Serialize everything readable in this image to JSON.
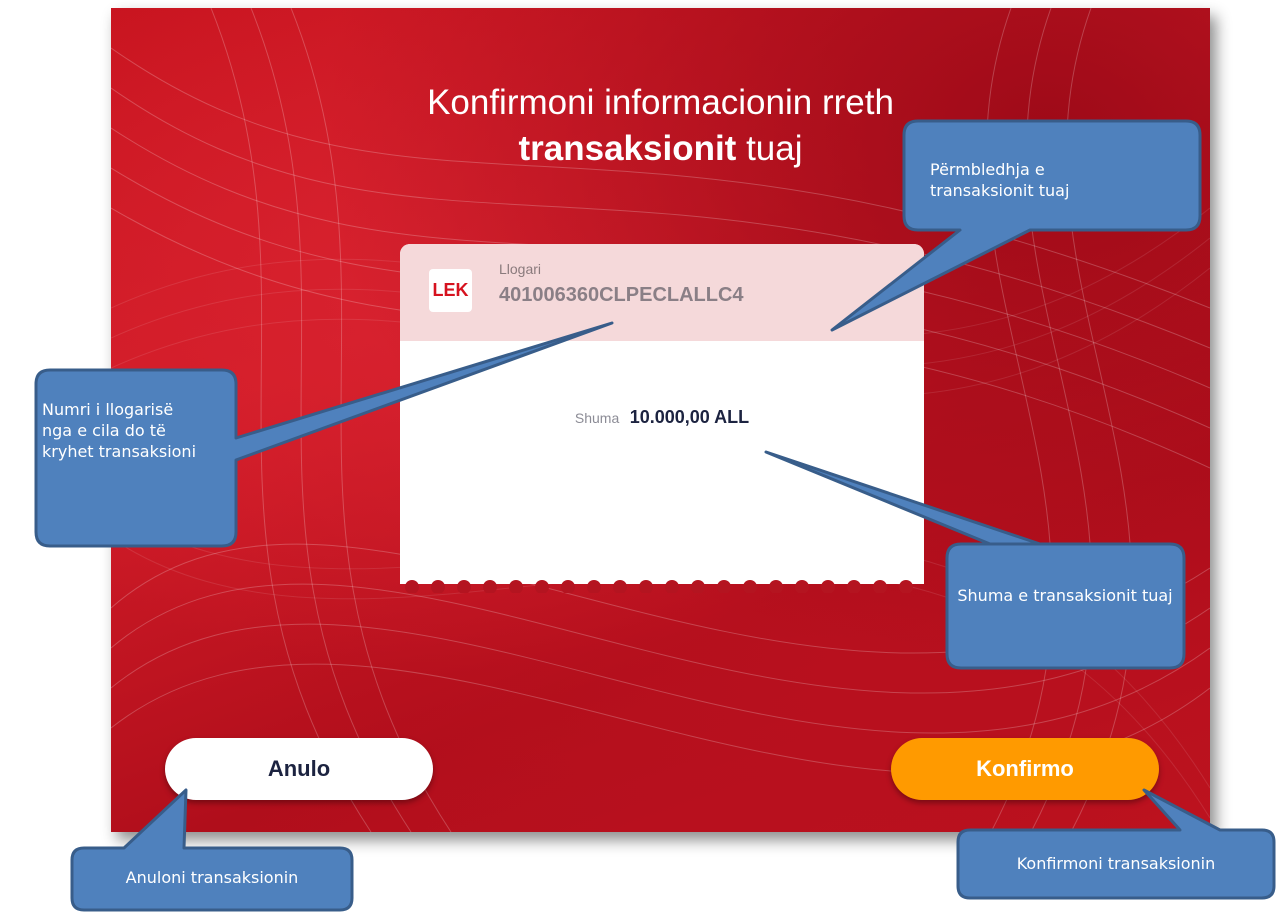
{
  "screen": {
    "title_line1": "Konfirmoni informacionin rreth",
    "title_bold": "transaksionit",
    "title_rest": " tuaj"
  },
  "card": {
    "currency_badge": "LEK",
    "account_label": "Llogari",
    "account_number": "401006360CLPECLALLC4",
    "amount_label": "Shuma",
    "amount_value": "10.000,00 ALL"
  },
  "buttons": {
    "cancel_label": "Anulo",
    "confirm_label": "Konfirmo"
  },
  "callouts": {
    "summary": "Përmbledhja e transaksionit tuaj",
    "account": "Numri i llogarisë nga e cila do të kryhet transaksioni",
    "amount": "Shuma e transaksionit tuaj",
    "cancel": "Anuloni transaksionin",
    "confirm": "Konfirmoni transaksionin"
  },
  "colors": {
    "screen_red": "#c8141f",
    "confirm_orange": "#ff9a00",
    "callout_blue": "#4f81bd",
    "callout_border": "#385d8a"
  }
}
